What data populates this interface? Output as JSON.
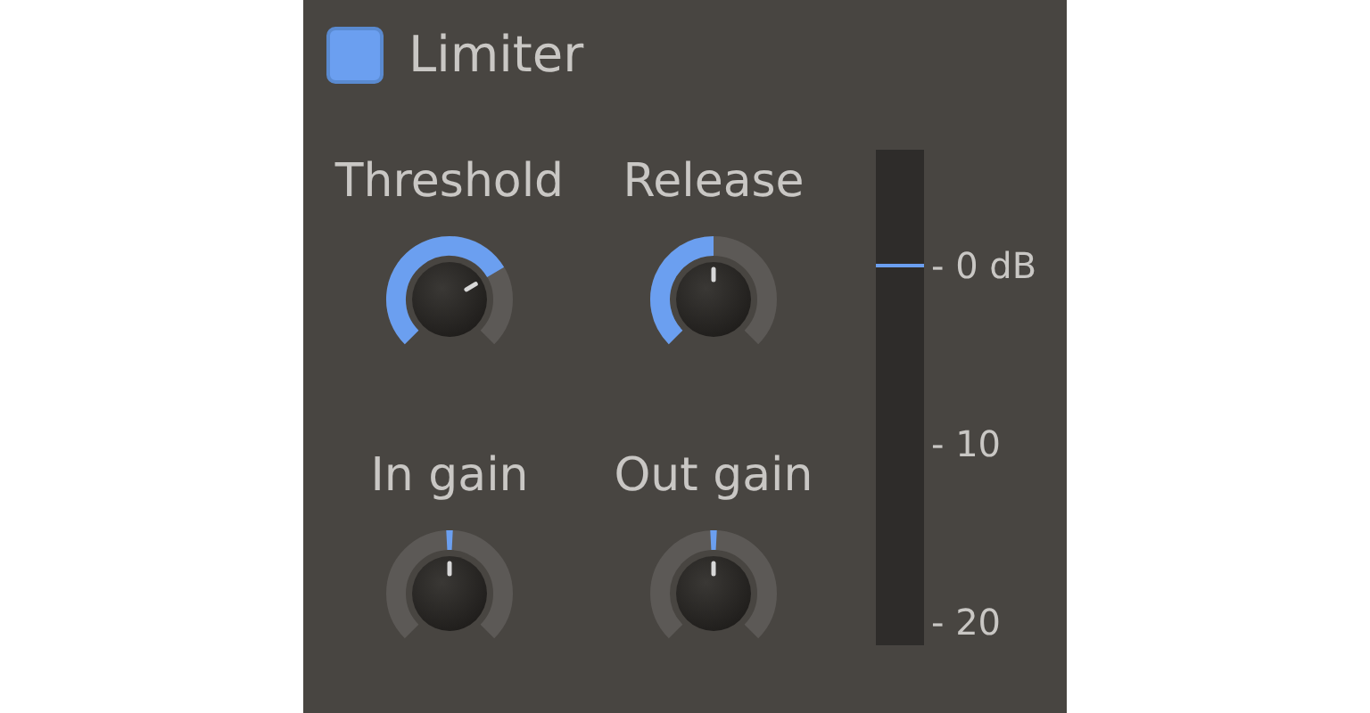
{
  "header": {
    "enabled": true,
    "title": "Limiter"
  },
  "knobs": [
    {
      "label": "Threshold",
      "kind": "unipolar"
    },
    {
      "label": "Release",
      "kind": "unipolar"
    },
    {
      "label": "In gain",
      "kind": "bipolar"
    },
    {
      "label": "Out gain",
      "kind": "bipolar"
    }
  ],
  "meter": {
    "scale": [
      "- 0 dB",
      "- 10",
      "- 20"
    ]
  }
}
